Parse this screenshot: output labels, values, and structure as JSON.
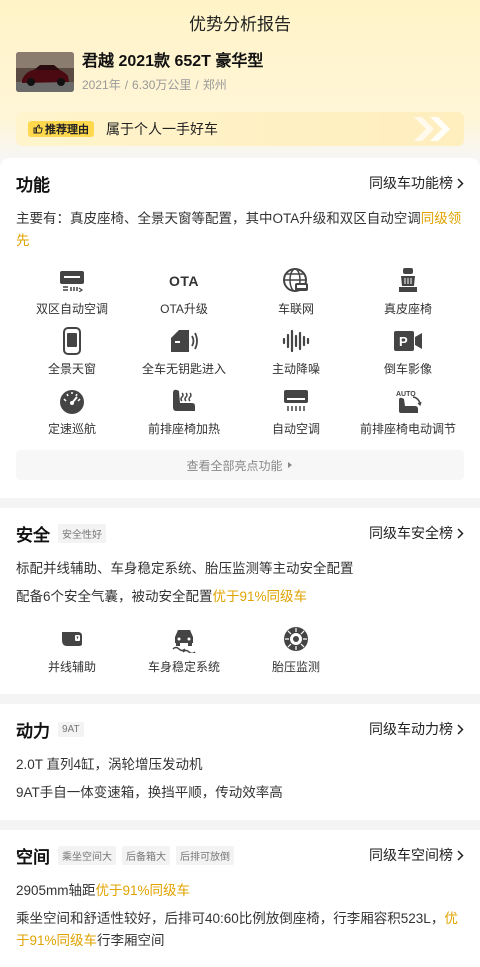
{
  "header": {
    "title": "优势分析报告"
  },
  "car": {
    "name": "君越 2021款 652T 豪华型",
    "year": "2021年",
    "mileage": "6.30万公里",
    "city": "郑州",
    "sep": "/"
  },
  "reason": {
    "tag": "推荐理由",
    "text": "属于个人一手好车"
  },
  "function": {
    "title": "功能",
    "link": "同级车功能榜",
    "desc_prefix": "主要有：真皮座椅、全景天窗等配置，其中OTA升级和双区自动空调",
    "desc_hl": "同级领先",
    "features": [
      {
        "icon": "dual-zone-ac-icon",
        "label": "双区自动空调"
      },
      {
        "icon": "ota-icon",
        "label": "OTA升级",
        "glyph": "OTA"
      },
      {
        "icon": "connected-car-icon",
        "label": "车联网"
      },
      {
        "icon": "leather-seat-icon",
        "label": "真皮座椅"
      },
      {
        "icon": "panoramic-sunroof-icon",
        "label": "全景天窗"
      },
      {
        "icon": "keyless-entry-icon",
        "label": "全车无钥匙进入"
      },
      {
        "icon": "noise-cancel-icon",
        "label": "主动降噪"
      },
      {
        "icon": "rear-camera-icon",
        "label": "倒车影像"
      },
      {
        "icon": "cruise-control-icon",
        "label": "定速巡航"
      },
      {
        "icon": "seat-heating-icon",
        "label": "前排座椅加热"
      },
      {
        "icon": "auto-ac-icon",
        "label": "自动空调"
      },
      {
        "icon": "power-seat-icon",
        "label": "前排座椅电动调节"
      }
    ],
    "all_button": "查看全部亮点功能"
  },
  "safety": {
    "title": "安全",
    "badge": "安全性好",
    "link": "同级车安全榜",
    "line1": "标配并线辅助、车身稳定系统、胎压监测等主动安全配置",
    "line2_prefix": "配备6个安全气囊，被动安全配置",
    "line2_hl": "优于91%同级车",
    "features": [
      {
        "icon": "lane-change-assist-icon",
        "label": "并线辅助"
      },
      {
        "icon": "stability-control-icon",
        "label": "车身稳定系统"
      },
      {
        "icon": "tire-pressure-icon",
        "label": "胎压监测"
      }
    ]
  },
  "power": {
    "title": "动力",
    "badge": "9AT",
    "link": "同级车动力榜",
    "line1": "2.0T 直列4缸，涡轮增压发动机",
    "line2": "9AT手自一体变速箱，换挡平顺，传动效率高"
  },
  "space": {
    "title": "空间",
    "badges": [
      "乘坐空间大",
      "后备箱大",
      "后排可放倒"
    ],
    "link": "同级车空间榜",
    "line1_prefix": "2905mm轴距",
    "line1_hl": "优于91%同级车",
    "line2_prefix": "乘坐空间和舒适性较好，后排可40:60比例放倒座椅，行李厢容积523L，",
    "line2_hl": "优于91%同级车",
    "line2_suffix": "行李厢空间"
  },
  "colors": {
    "accent": "#e0a300",
    "tag_bg": "#ffd84d",
    "header_bg": "#fff3c7"
  }
}
